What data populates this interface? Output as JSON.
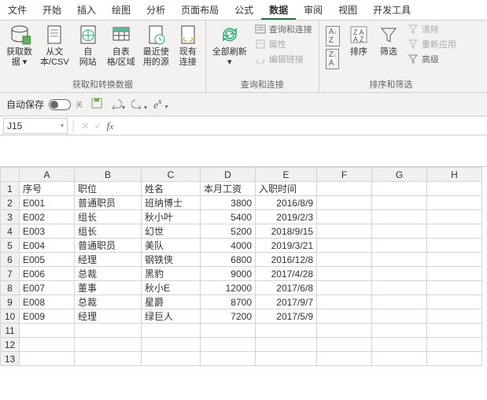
{
  "menu": {
    "tabs": [
      "文件",
      "开始",
      "插入",
      "绘图",
      "分析",
      "页面布局",
      "公式",
      "数据",
      "审阅",
      "视图",
      "开发工具"
    ],
    "active": 7
  },
  "ribbon": {
    "group1": {
      "label": "获取和转换数据",
      "btn_get": "获取数\n据 ▾",
      "btn_csv": "从文\n本/CSV",
      "btn_web": "自\n网站",
      "btn_table": "自表\n格/区域",
      "btn_recent": "最近使\n用的源",
      "btn_conn": "现有\n连接"
    },
    "group2": {
      "label": "查询和连接",
      "btn_refresh": "全部刷新\n▾",
      "opt_qc": "查询和连接",
      "opt_prop": "属性",
      "opt_edit": "编辑链接"
    },
    "group3": {
      "label": "排序和筛选",
      "btn_az": "A↓Z",
      "btn_za": "Z↓A",
      "btn_sort": "排序",
      "btn_filter": "筛选",
      "opt_clear": "清除",
      "opt_reapply": "重新应用",
      "opt_adv": "高级"
    }
  },
  "qa": {
    "autosave_label": "自动保存",
    "autosave_state": "关"
  },
  "formula": {
    "namebox": "J15"
  },
  "sheet": {
    "columns": [
      "A",
      "B",
      "C",
      "D",
      "E",
      "F",
      "G",
      "H"
    ],
    "headers": [
      "序号",
      "职位",
      "姓名",
      "本月工资",
      "入职时间"
    ],
    "rows": [
      {
        "a": "E001",
        "b": "普通职员",
        "c": "班纳博士",
        "d": 3800,
        "e": "2016/8/9"
      },
      {
        "a": "E002",
        "b": "组长",
        "c": "秋小叶",
        "d": 5400,
        "e": "2019/2/3"
      },
      {
        "a": "E003",
        "b": "组长",
        "c": "幻世",
        "d": 5200,
        "e": "2018/9/15"
      },
      {
        "a": "E004",
        "b": "普通职员",
        "c": "美队",
        "d": 4000,
        "e": "2019/3/21"
      },
      {
        "a": "E005",
        "b": "经理",
        "c": "钢铁侠",
        "d": 6800,
        "e": "2016/12/8"
      },
      {
        "a": "E006",
        "b": "总裁",
        "c": "黑豹",
        "d": 9000,
        "e": "2017/4/28"
      },
      {
        "a": "E007",
        "b": "董事",
        "c": "秋小E",
        "d": 12000,
        "e": "2017/6/8"
      },
      {
        "a": "E008",
        "b": "总裁",
        "c": "星爵",
        "d": 8700,
        "e": "2017/9/7"
      },
      {
        "a": "E009",
        "b": "经理",
        "c": "绿巨人",
        "d": 7200,
        "e": "2017/5/9"
      }
    ],
    "blank_rows": 3
  }
}
